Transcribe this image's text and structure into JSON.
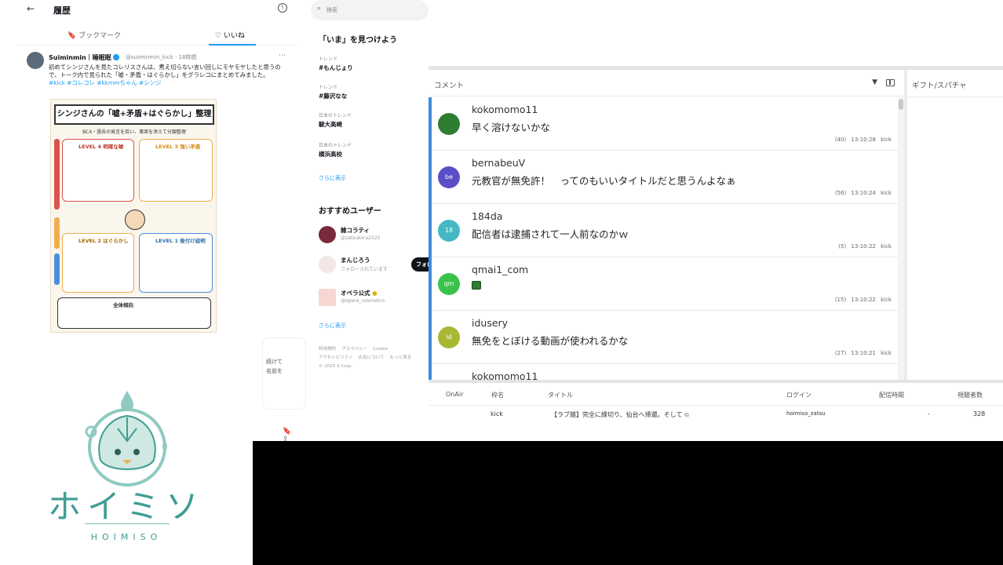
{
  "history": {
    "back_icon": "arrow-left-icon",
    "title": "履歴",
    "tabs": [
      {
        "label": "ブックマーク"
      },
      {
        "label": "いいね"
      }
    ],
    "tweet": {
      "author": "Suiminmin｜睡眠眠",
      "handle_time": "@suiminmin_kick · 18時間",
      "text": "初めてシンジさんを見たコレリスさんは、煮え切らない言い回しにモヤモヤしたと思うので、トーク内で見られた「嘘・矛盾・はぐらかし」をグラレコにまとめてみました。",
      "tags": "#kick #コレコレ #kkmmちゃん #シンジ",
      "more_icon": "more-icon",
      "infographic": {
        "title": "シンジさんの「嘘+矛盾+はぐらかし」整理",
        "subtitle": "BC4・過去の発言を拾い、事実を添えて分類整理",
        "levels": [
          "LEVEL 4 明確な嘘",
          "LEVEL 3 強い矛盾",
          "LEVEL 2 はぐらかし",
          "LEVEL 1 後付け説明"
        ],
        "footer": "全体傾向"
      }
    },
    "card_text": "続けて\n名前を"
  },
  "logo": {
    "text_jp": "ホイミソ",
    "text_en": "HOIMISO",
    "color": "#3f9d93"
  },
  "sidebar": {
    "search_placeholder": "検索",
    "trends_title": "「いま」を見つけよう",
    "trends": [
      {
        "category": "トレンド",
        "name": "#もんじょり"
      },
      {
        "category": "トレンド",
        "name": "#藤沢なな"
      },
      {
        "category": "日本のトレンド",
        "name": "駿大高崎"
      },
      {
        "category": "日本のトレンド",
        "name": "横浜高校"
      }
    ],
    "show_more": "さらに表示",
    "recommended_title": "おすすめユーザー",
    "users": [
      {
        "name": "雑コラティ",
        "handle": "@zatsukora2525",
        "follow": ""
      },
      {
        "name": "まんじろう",
        "handle": "フォローされています",
        "follow": "フォロー"
      },
      {
        "name": "オペラ公式",
        "handle": "@opera_cosmetics",
        "follow": ""
      }
    ],
    "footer": [
      "利用規約",
      "プライバシー",
      "Cookie",
      "アクセシビリティ",
      "広告について",
      "もっと見る",
      "© 2025 X Corp."
    ]
  },
  "comments": {
    "header": "コメント",
    "gift_header": "ギフト/スパチャ",
    "items": [
      {
        "avatar_text": "",
        "avatar_color": "#2e7d32",
        "user": "kokomomo11",
        "text": "早く溶けないかな",
        "meta": "(40) 13:10:28 kick"
      },
      {
        "avatar_text": "be",
        "avatar_color": "#5b4fc7",
        "user": "bernabeuV",
        "text": "元教官が無免許！　ってのもいいタイトルだと思うんよなぁ",
        "meta": "(56) 13:10:24 kick"
      },
      {
        "avatar_text": "18",
        "avatar_color": "#45b8c4",
        "user": "184da",
        "text": "配信者は逮捕されて一人前なのかｗ",
        "meta": "(5) 13:10:22 kick"
      },
      {
        "avatar_text": "qm",
        "avatar_color": "#3ac24a",
        "user": "qmai1_com",
        "text": "",
        "meta": "(15) 13:10:22 kick"
      },
      {
        "avatar_text": "id",
        "avatar_color": "#a8b833",
        "user": "idusery",
        "text": "無免をとぼける動画が使われるかな",
        "meta": "(27) 13:10:21 kick"
      },
      {
        "avatar_text": "",
        "avatar_color": "#2e7d32",
        "user": "kokomomo11",
        "text": "",
        "meta": ""
      }
    ]
  },
  "stream_table": {
    "headers": [
      "OnAir",
      "枠名",
      "タイトル",
      "ログイン",
      "配信時間",
      "視聴者数"
    ],
    "row": {
      "onair": "",
      "frame": "kick",
      "title": "【ラブ雑】完全に縁切り、仙台へ帰還。そして",
      "login": "hoimiso_zatsu",
      "duration": "-",
      "viewers": "328"
    }
  }
}
